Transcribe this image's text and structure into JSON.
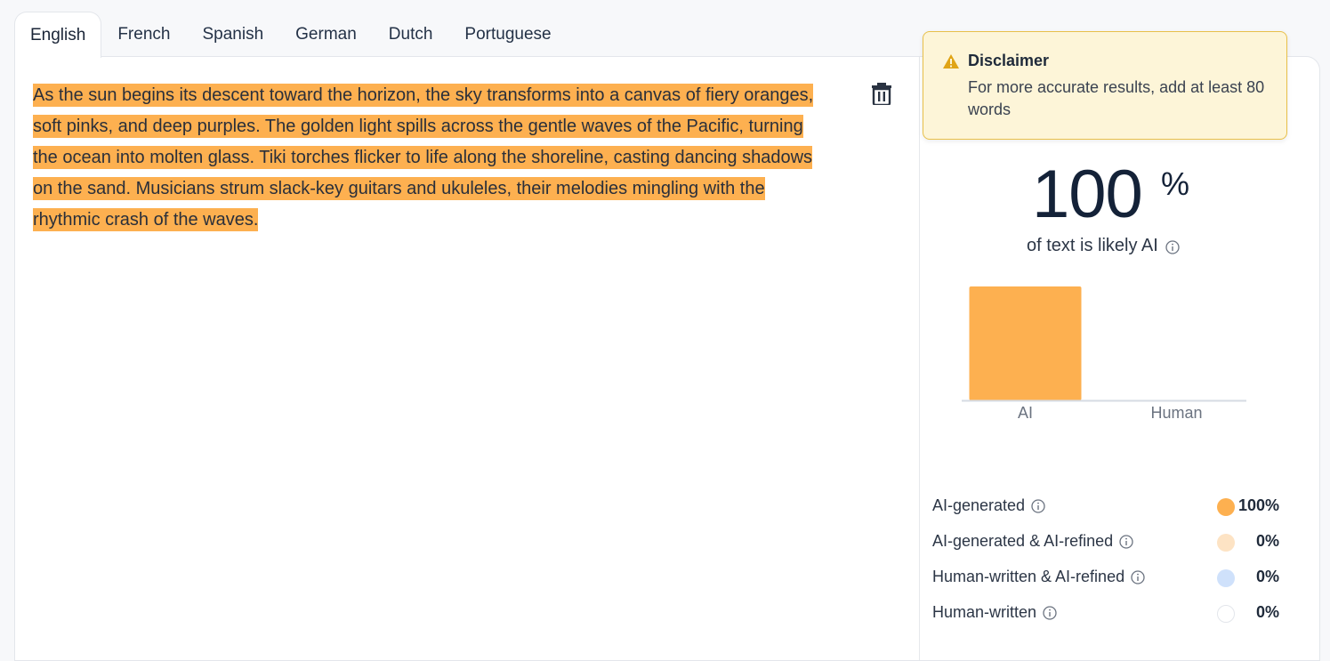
{
  "tabs": [
    {
      "label": "English",
      "active": true
    },
    {
      "label": "French"
    },
    {
      "label": "Spanish"
    },
    {
      "label": "German"
    },
    {
      "label": "Dutch"
    },
    {
      "label": "Portuguese"
    }
  ],
  "editor": {
    "lines": [
      "As the sun begins its descent toward the horizon, the sky transforms into a canvas of fiery oranges,",
      "soft pinks, and deep purples. The golden light spills across the gentle waves of the Pacific, turning",
      "the ocean into molten glass. Tiki torches flicker to life along the shoreline, casting dancing shadows",
      "on the sand. Musicians strum slack-key guitars and ukuleles, their melodies mingling with the",
      "rhythmic crash of the waves."
    ],
    "highlight_color": "#fdb050"
  },
  "disclaimer": {
    "title": "Disclaimer",
    "body": "For more accurate results, add at least 80 words"
  },
  "result": {
    "percent": "100",
    "percent_sign": "%",
    "caption": "of text is likely AI"
  },
  "chart_data": {
    "type": "bar",
    "categories": [
      "AI",
      "Human"
    ],
    "values": [
      100,
      0
    ],
    "ylim": [
      0,
      100
    ],
    "colors": [
      "#fdb050",
      "#d6dbe3"
    ],
    "grid": false
  },
  "legend": [
    {
      "label": "AI-generated",
      "value": "100%",
      "color": "#fdb050"
    },
    {
      "label": "AI-generated & AI-refined",
      "value": "0%",
      "color": "#fde3c4"
    },
    {
      "label": "Human-written & AI-refined",
      "value": "0%",
      "color": "#cfe1fb"
    },
    {
      "label": "Human-written",
      "value": "0%",
      "color": "#ffffff"
    }
  ]
}
